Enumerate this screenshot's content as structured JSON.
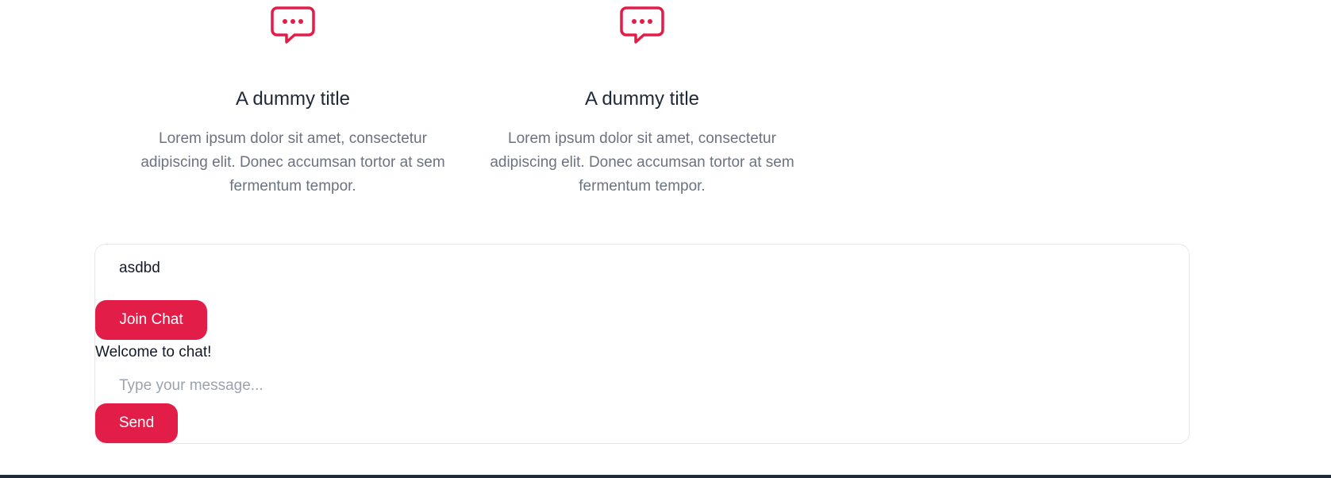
{
  "features": [
    {
      "icon": "chat-bubble-dots-icon",
      "title": "A dummy title",
      "description": "Lorem ipsum dolor sit amet, consectetur adipiscing elit. Donec accumsan tortor at sem fermentum tempor."
    },
    {
      "icon": "chat-bubble-dots-icon",
      "title": "A dummy title",
      "description": "Lorem ipsum dolor sit amet, consectetur adipiscing elit. Donec accumsan tortor at sem fermentum tempor."
    }
  ],
  "chat": {
    "name_value": "asdbd",
    "join_label": "Join Chat",
    "welcome_text": "Welcome to chat!",
    "message_placeholder": "Type your message...",
    "send_label": "Send"
  },
  "colors": {
    "accent": "#e11d48",
    "title_text": "#1f2937",
    "body_text": "#6b7280",
    "footer": "#1f2937"
  }
}
